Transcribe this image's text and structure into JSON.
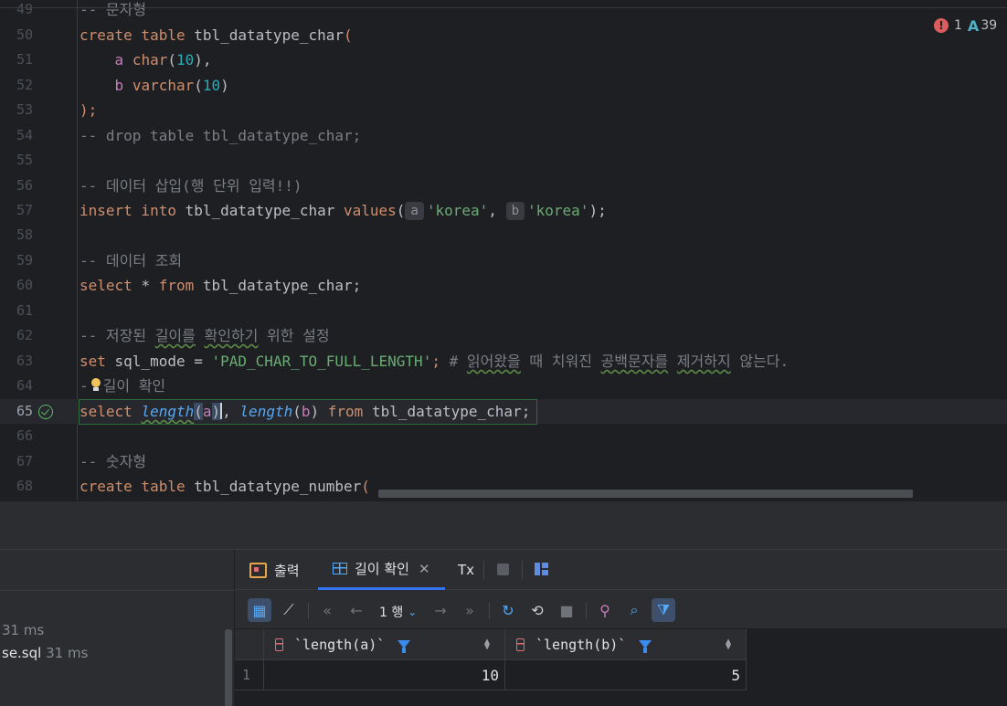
{
  "editor": {
    "lines": [
      {
        "num": "49",
        "text": "-- 문자형"
      },
      {
        "num": "50",
        "text": "create table tbl_datatype_char("
      },
      {
        "num": "51",
        "text": "a char(10),"
      },
      {
        "num": "52",
        "text": "b varchar(10)"
      },
      {
        "num": "53",
        "text": ");"
      },
      {
        "num": "54",
        "text": "-- drop table tbl_datatype_char;"
      },
      {
        "num": "55",
        "text": ""
      },
      {
        "num": "56",
        "text": "-- 데이터 삽입(행 단위 입력!!)"
      },
      {
        "num": "57",
        "text": "insert into tbl_datatype_char values(a'korea', b'korea');"
      },
      {
        "num": "58",
        "text": ""
      },
      {
        "num": "59",
        "text": "-- 데이터 조회"
      },
      {
        "num": "60",
        "text": "select * from tbl_datatype_char;"
      },
      {
        "num": "61",
        "text": ""
      },
      {
        "num": "62",
        "text": "-- 저장된 길이를 확인하기 위한 설정"
      },
      {
        "num": "63",
        "text": "set sql_mode = 'PAD_CHAR_TO_FULL_LENGTH'; # 읽어왔을 때 치워진 공백문자를 제거하지 않는다."
      },
      {
        "num": "64",
        "text": "-길이 확인"
      },
      {
        "num": "65",
        "text": "select length(a), length(b) from tbl_datatype_char;"
      },
      {
        "num": "66",
        "text": ""
      },
      {
        "num": "67",
        "text": "-- 숫자형"
      },
      {
        "num": "68",
        "text": "create table tbl_datatype_number("
      }
    ],
    "inspection": {
      "errors": "1",
      "typos": "39"
    },
    "param_hint_a": "a",
    "param_hint_b": "b"
  },
  "left_panel": {
    "items": [
      {
        "name": "",
        "duration": "31 ms"
      },
      {
        "name": "se.sql",
        "duration": "31 ms"
      }
    ]
  },
  "results": {
    "tabs": [
      {
        "label": "출력",
        "icon": "output-icon"
      },
      {
        "label": "길이 확인",
        "icon": "table-icon",
        "closable": true
      },
      {
        "label": "Tx",
        "icon": ""
      }
    ],
    "rows_selector": "1 행",
    "columns": [
      "`length(a)`",
      "`length(b)`"
    ],
    "rows": [
      {
        "num": "1",
        "cells": [
          "10",
          "5"
        ]
      }
    ]
  },
  "colors": {
    "keyword": "#cf8e6d",
    "comment": "#7a7e85",
    "string": "#6aab73",
    "number": "#2aacb8",
    "function": "#56a8f5",
    "accent": "#3574f0"
  }
}
